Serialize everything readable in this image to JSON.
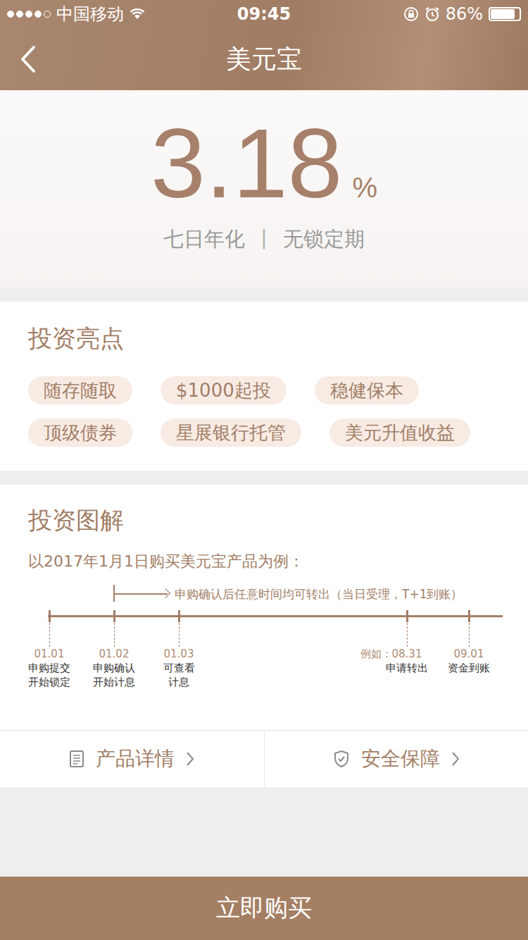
{
  "status_bar": {
    "signal_level": 0.8,
    "carrier": "中国移动",
    "time": "09:45",
    "battery": "86%",
    "battery_level": 0.86
  },
  "nav": {
    "title": "美元宝"
  },
  "rate": {
    "value": "3.18",
    "unit": "%",
    "meta": [
      "七日年化",
      "无锁定期"
    ],
    "separator": "|"
  },
  "highlights": {
    "title": "投资亮点",
    "tags": [
      "随存随取",
      "$1000起投",
      "稳健保本",
      "顶级债券",
      "星展银行托管",
      "美元升值收益"
    ]
  },
  "diagram": {
    "title": "投资图解",
    "example": "以2017年1月1日购买美元宝产品为例：",
    "note": "申购确认后任意时间均可转出（当日受理，T+1到账）",
    "points": [
      {
        "prefix": "",
        "date": "01.01",
        "lines": [
          "申购提交",
          "开始锁定"
        ]
      },
      {
        "prefix": "",
        "date": "01.02",
        "lines": [
          "申购确认",
          "开始计息"
        ]
      },
      {
        "prefix": "",
        "date": "01.03",
        "lines": [
          "可查看",
          "计息"
        ]
      },
      {
        "prefix": "例如：",
        "date": "08.31",
        "lines": [
          "申请转出"
        ]
      },
      {
        "prefix": "",
        "date": "09.01",
        "lines": [
          "资金到账"
        ]
      }
    ]
  },
  "links": [
    {
      "label": "产品详情",
      "kind": "document"
    },
    {
      "label": "安全保障",
      "kind": "shield"
    }
  ],
  "buy_button": "立即购买"
}
